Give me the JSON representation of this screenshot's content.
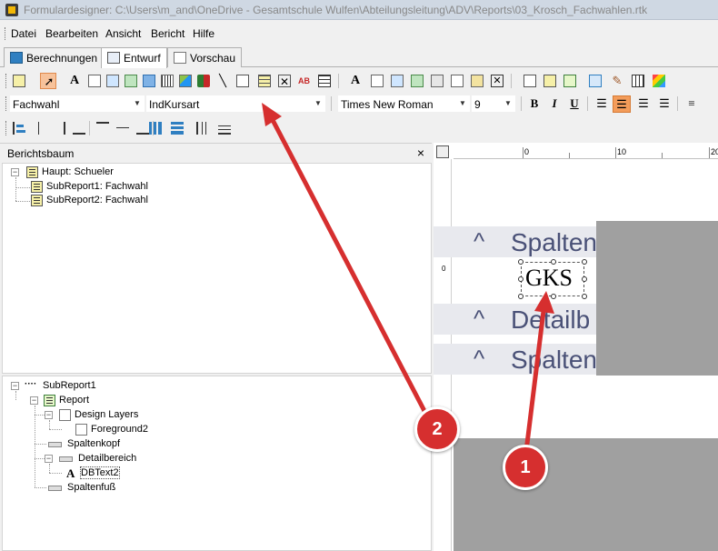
{
  "window": {
    "title": "Formulardesigner: C:\\Users\\m_and\\OneDrive - Gesamtschule Wulfen\\Abteilungsleitung\\ADV\\Reports\\03_Krosch_Fachwahlen.rtk"
  },
  "menu": [
    "Datei",
    "Bearbeiten",
    "Ansicht",
    "Bericht",
    "Hilfe"
  ],
  "tabs": [
    {
      "label": "Berechnungen",
      "active": false
    },
    {
      "label": "Entwurf",
      "active": true
    },
    {
      "label": "Vorschau",
      "active": false
    }
  ],
  "format_toolbar": {
    "datapipeline": "Fachwahl",
    "datafield": "IndKursart",
    "font_name": "Times New Roman",
    "font_size": "9",
    "bold": "B",
    "italic": "I",
    "underline": "U"
  },
  "report_tree_panel": {
    "title": "Berichtsbaum",
    "close": "×",
    "items": [
      "Haupt: Schueler",
      "SubReport1: Fachwahl",
      "SubReport2: Fachwahl"
    ]
  },
  "report_outline": {
    "root": "SubReport1",
    "items": [
      "Report",
      "Design Layers",
      "Foreground2",
      "Spaltenkopf",
      "Detailbereich",
      "DBText2",
      "Spaltenfuß"
    ]
  },
  "designer": {
    "ruler_labels": [
      "0",
      "10",
      "20"
    ],
    "left_ruler_label": "0",
    "bands": [
      "Spalten",
      "Detailb",
      "Spalten"
    ],
    "caret": "^",
    "dbtext_value": "GKS"
  },
  "annotations": [
    "1",
    "2"
  ],
  "colors": {
    "annotation": "#d62f2f",
    "band_text": "#4a5177",
    "band_bg": "#e8e9ee",
    "active_align": "#f39c5a"
  }
}
